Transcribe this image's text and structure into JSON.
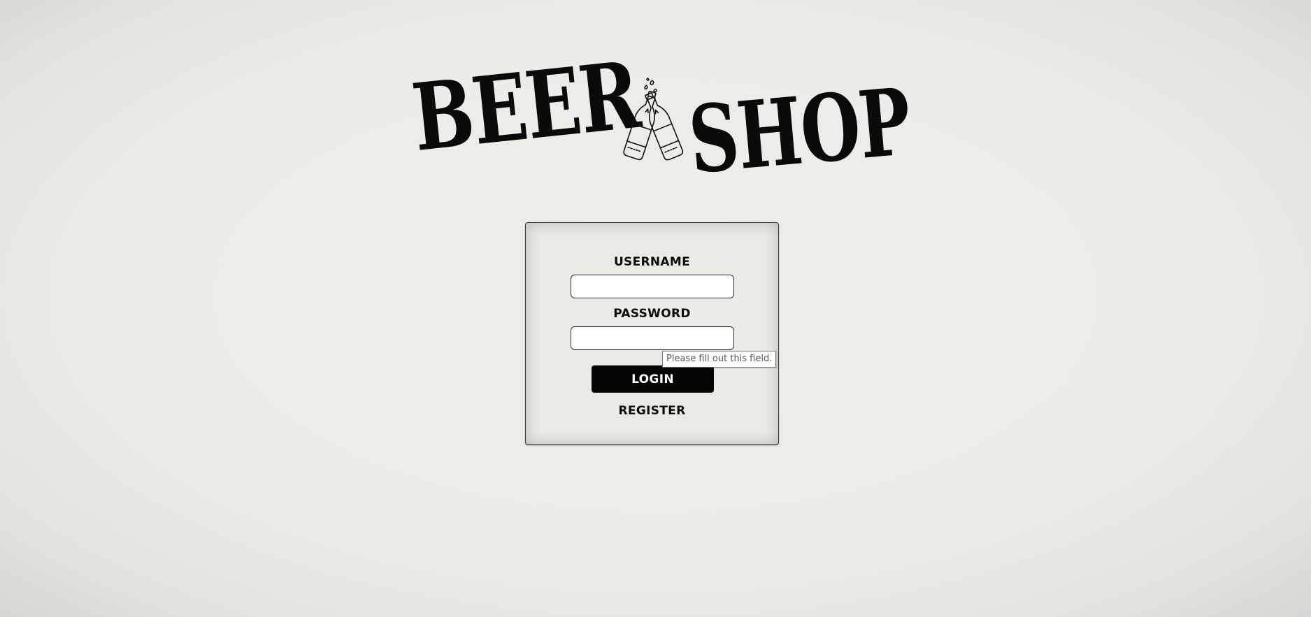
{
  "logo": {
    "left_word": "BEER",
    "right_word": "SHOP",
    "icon": "beer-bottles-cheers-icon"
  },
  "login_form": {
    "username_label": "USERNAME",
    "username_value": "",
    "password_label": "PASSWORD",
    "password_value": "",
    "login_button_label": "LOGIN",
    "register_link_label": "REGISTER"
  },
  "validation_tooltip": {
    "text": "Please fill out this field."
  },
  "colors": {
    "background": "#ecece7",
    "text": "#0a0a0a",
    "button_bg": "#050505",
    "button_text": "#ffffff"
  }
}
